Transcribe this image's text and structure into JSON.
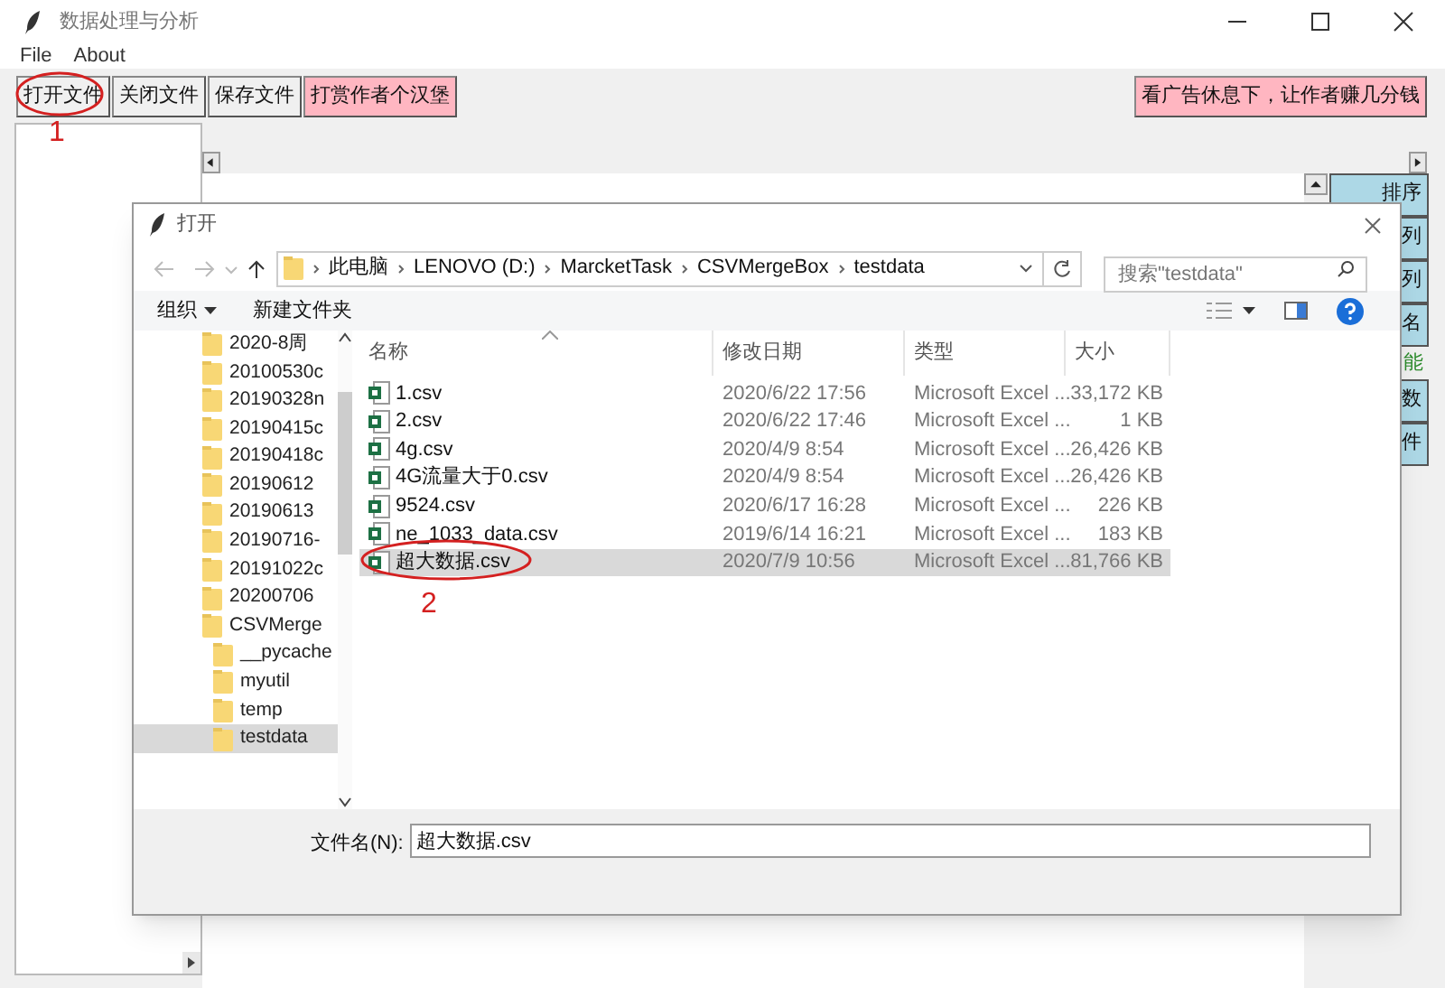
{
  "window": {
    "title": "数据处理与分析"
  },
  "menu": [
    "File",
    "About"
  ],
  "toolbar": [
    {
      "label": "打开文件",
      "kind": "plain"
    },
    {
      "label": "关闭文件",
      "kind": "plain"
    },
    {
      "label": "保存文件",
      "kind": "plain"
    },
    {
      "label": "打赏作者个汉堡",
      "kind": "pink"
    }
  ],
  "ad_button": {
    "label": "看广告休息下，让作者赚几分钱"
  },
  "side_buttons": [
    {
      "label": "排序",
      "kind": "button"
    },
    {
      "label": "列",
      "kind": "button"
    },
    {
      "label": "列",
      "kind": "button"
    },
    {
      "label": "名",
      "kind": "button"
    },
    {
      "label": "能",
      "kind": "label"
    },
    {
      "label": "数",
      "kind": "button"
    },
    {
      "label": "件",
      "kind": "button"
    }
  ],
  "dialog": {
    "title": "打开",
    "breadcrumb": [
      "此电脑",
      "LENOVO (D:)",
      "MarcketTask",
      "CSVMergeBox",
      "testdata"
    ],
    "search": {
      "placeholder": "搜索\"testdata\""
    },
    "organize": "组织",
    "new_folder": "新建文件夹",
    "nav": [
      {
        "label": "2020-8周",
        "selected": false
      },
      {
        "label": "20100530c",
        "selected": false
      },
      {
        "label": "20190328n",
        "selected": false
      },
      {
        "label": "20190415c",
        "selected": false
      },
      {
        "label": "20190418c",
        "selected": false
      },
      {
        "label": "20190612",
        "selected": false
      },
      {
        "label": "20190613",
        "selected": false
      },
      {
        "label": "20190716-",
        "selected": false
      },
      {
        "label": "20191022c",
        "selected": false
      },
      {
        "label": "20200706",
        "selected": false
      },
      {
        "label": "CSVMerge",
        "selected": false,
        "children": [
          {
            "label": "__pycache",
            "selected": false
          },
          {
            "label": "myutil",
            "selected": false
          },
          {
            "label": "temp",
            "selected": false
          },
          {
            "label": "testdata",
            "selected": true
          }
        ]
      }
    ],
    "columns": [
      "名称",
      "修改日期",
      "类型",
      "大小"
    ],
    "files": [
      {
        "name": "1.csv",
        "modified": "2020/6/22 17:56",
        "type": "Microsoft Excel ...",
        "size": "33,172 KB",
        "selected": false
      },
      {
        "name": "2.csv",
        "modified": "2020/6/22 17:46",
        "type": "Microsoft Excel ...",
        "size": "1 KB",
        "selected": false
      },
      {
        "name": "4g.csv",
        "modified": "2020/4/9 8:54",
        "type": "Microsoft Excel ...",
        "size": "26,426 KB",
        "selected": false
      },
      {
        "name": "4G流量大于0.csv",
        "modified": "2020/4/9 8:54",
        "type": "Microsoft Excel ...",
        "size": "26,426 KB",
        "selected": false
      },
      {
        "name": "9524.csv",
        "modified": "2020/6/17 16:28",
        "type": "Microsoft Excel ...",
        "size": "226 KB",
        "selected": false
      },
      {
        "name": "ne_1033_data.csv",
        "modified": "2019/6/14 16:21",
        "type": "Microsoft Excel ...",
        "size": "183 KB",
        "selected": false
      },
      {
        "name": "超大数据.csv",
        "modified": "2020/7/9 10:56",
        "type": "Microsoft Excel ...",
        "size": "81,766 KB",
        "selected": true
      }
    ],
    "filename": {
      "label": "文件名(N):",
      "value": "超大数据.csv"
    }
  },
  "annotations": [
    "1",
    "2"
  ]
}
